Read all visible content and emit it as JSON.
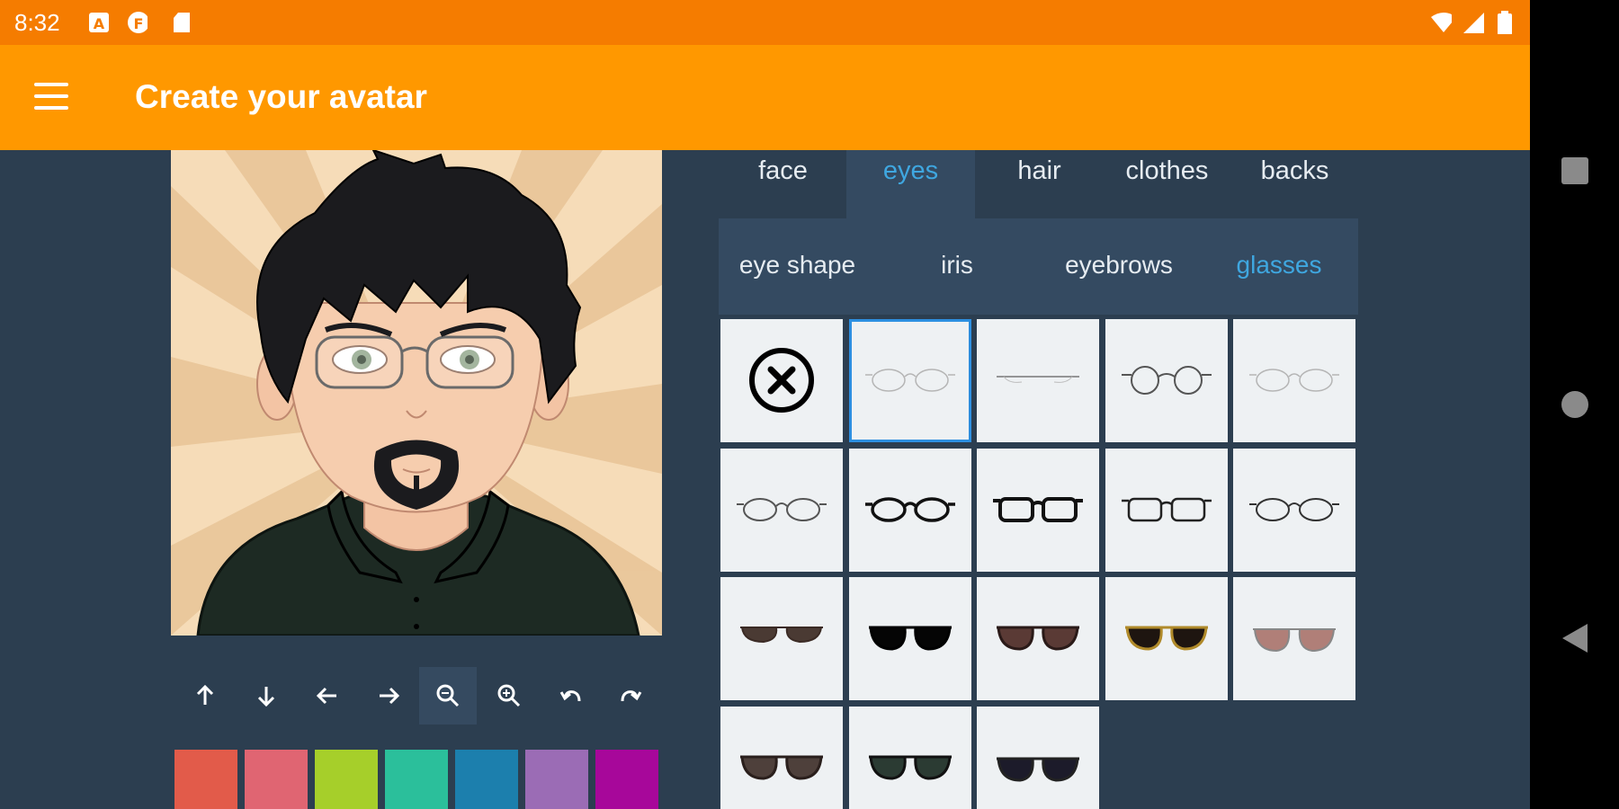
{
  "status_bar": {
    "time": "8:32"
  },
  "app_bar": {
    "title": "Create your avatar",
    "menu_icon": "menu-icon"
  },
  "colors": {
    "status_bar": "#f57c00",
    "app_bar": "#ff9800",
    "background": "#2c3e50",
    "panel": "#344a61",
    "accent": "#3fa7e0"
  },
  "tabs": [
    {
      "label": "face",
      "active": false
    },
    {
      "label": "eyes",
      "active": true
    },
    {
      "label": "hair",
      "active": false
    },
    {
      "label": "clothes",
      "active": false
    },
    {
      "label": "backs",
      "active": false
    }
  ],
  "subtabs": [
    {
      "label": "eye shape",
      "active": false
    },
    {
      "label": "iris",
      "active": false
    },
    {
      "label": "eyebrows",
      "active": false
    },
    {
      "label": "glasses",
      "active": true
    }
  ],
  "tools": [
    "arrow-up-icon",
    "arrow-down-icon",
    "arrow-left-icon",
    "arrow-right-icon",
    "zoom-out-icon",
    "zoom-in-icon",
    "undo-icon",
    "redo-icon"
  ],
  "swatch_colors": [
    "#e25b4a",
    "#e06572",
    "#a6cf2a",
    "#2bbf9b",
    "#1c7fad",
    "#9b6cb5",
    "#a7079a"
  ],
  "glasses_options": [
    "none",
    "thin-oval-light",
    "rimless-bar",
    "round-thin",
    "oval-light",
    "oval-thin",
    "oval-black",
    "rectangular-black",
    "half-rim-black",
    "oval-black-thin",
    "sunglasses-slim-brown",
    "sunglasses-black",
    "sunglasses-dark-brown",
    "sunglasses-gold",
    "aviator-brown",
    "sunglasses-round-brown",
    "sunglasses-green",
    "aviator-gradient"
  ],
  "selected_glasses_index": 1
}
